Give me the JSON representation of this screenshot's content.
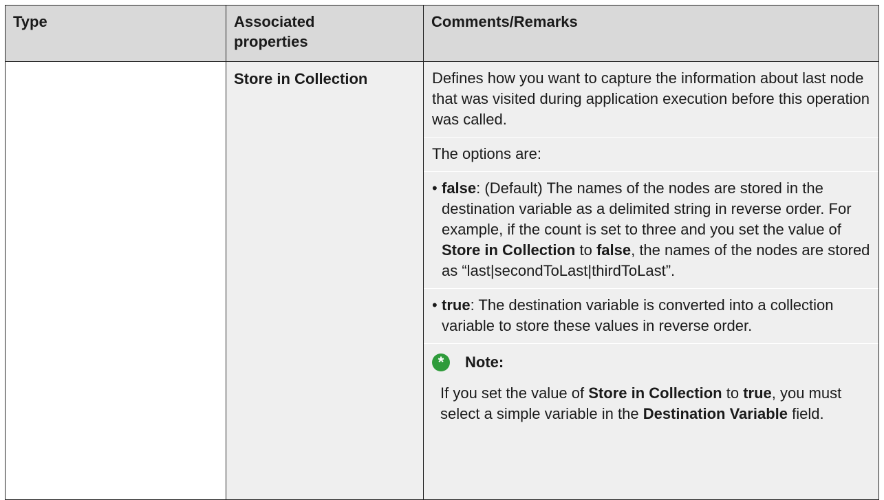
{
  "table": {
    "headers": {
      "type": "Type",
      "props_line1": "Associated",
      "props_line2": "properties",
      "comments": "Comments/Remarks"
    },
    "row": {
      "type": "",
      "property": "Store in Collection",
      "description": "Defines how you want to capture the information about last node that was visited during application execution before this operation was called.",
      "options_intro": "The options are:",
      "option_false": {
        "bullet": "•",
        "key": "false",
        "text_a": ": (Default) The names of the nodes are stored in the destination variable as a delimited string in reverse order. For example, if the count is set to three and you set the value of ",
        "bold_prop": "Store in Collection",
        "text_b": " to ",
        "bold_false": "false",
        "text_c": ", the names of the nodes are stored as “last|secondToLast|thirdToLast”."
      },
      "option_true": {
        "bullet": "•",
        "key": "true",
        "text": ": The destination variable is converted into a collection variable to store these values in reverse order."
      },
      "note": {
        "icon": "asterisk-icon",
        "icon_glyph": "*",
        "label": "Note:",
        "text_a": "If you set the value of ",
        "bold_prop": "Store in Collection",
        "text_b": " to ",
        "bold_true": "true",
        "text_c": ", you must select a simple variable in the ",
        "bold_field": "Destination Variable",
        "text_d": " field."
      }
    }
  },
  "colors": {
    "header_bg": "#d9d9d9",
    "cell_bg": "#efefef",
    "note_icon": "#2e9b3a",
    "border": "#222222"
  }
}
